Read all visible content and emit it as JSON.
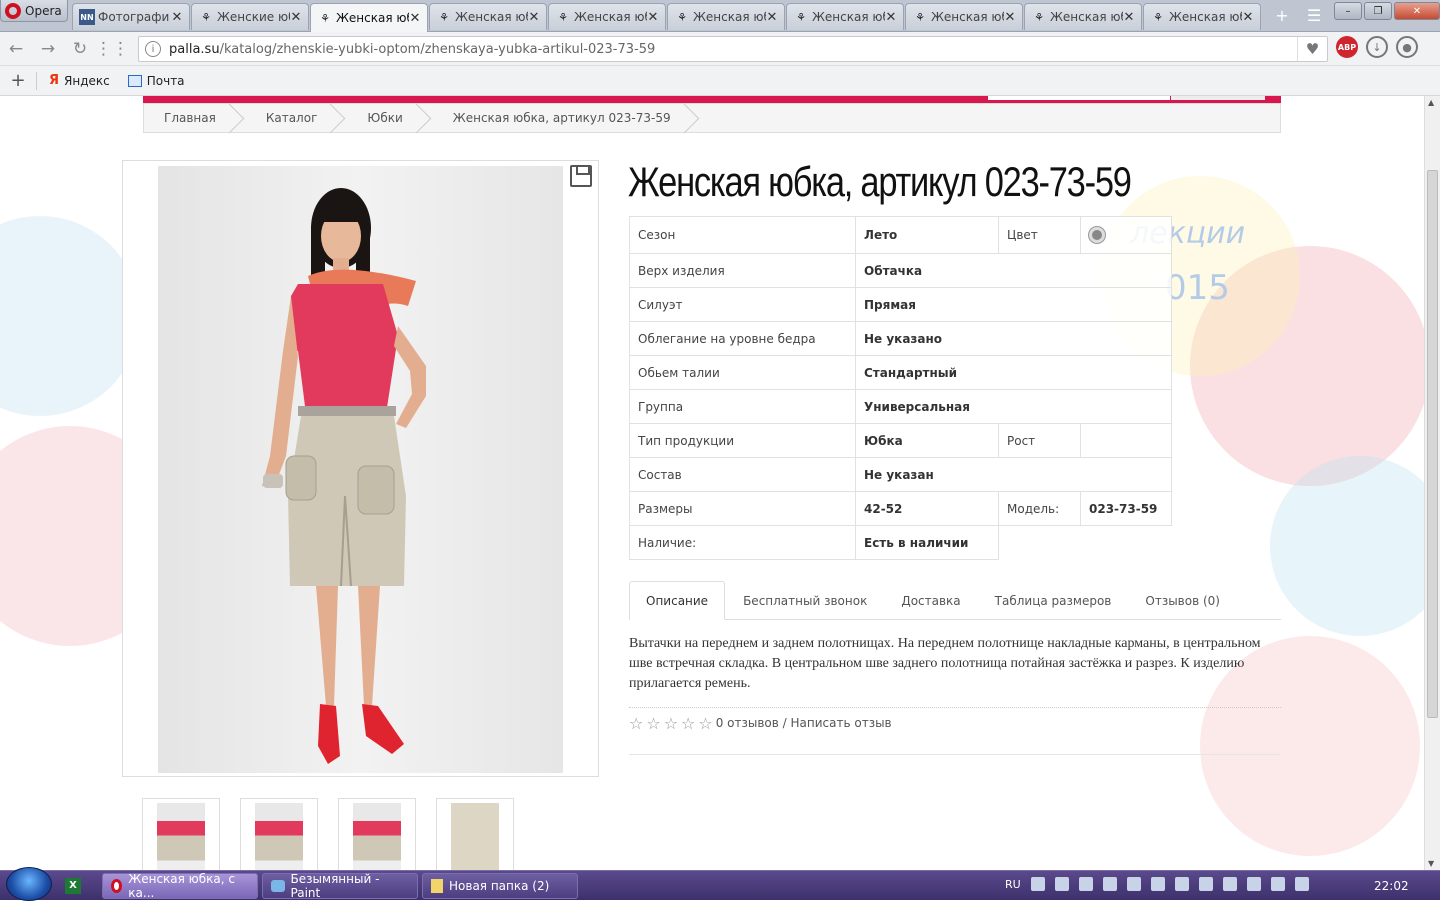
{
  "browser": {
    "app_name": "Opera",
    "tabs": [
      {
        "label": "Фотографи",
        "icon": "nn",
        "active": false
      },
      {
        "label": "Женские юб",
        "icon": "palla",
        "active": false
      },
      {
        "label": "Женская юб",
        "icon": "palla",
        "active": true
      },
      {
        "label": "Женская юб",
        "icon": "palla",
        "active": false
      },
      {
        "label": "Женская юб",
        "icon": "palla",
        "active": false
      },
      {
        "label": "Женская юб",
        "icon": "palla",
        "active": false
      },
      {
        "label": "Женская юб",
        "icon": "palla",
        "active": false
      },
      {
        "label": "Женская юб",
        "icon": "palla",
        "active": false
      },
      {
        "label": "Женская юб",
        "icon": "palla",
        "active": false
      },
      {
        "label": "Женская юб",
        "icon": "palla",
        "active": false
      }
    ],
    "nn_badge": "NN",
    "url_host": "palla.su",
    "url_path": "/katalog/zhenskie-yubki-optom/zhenskaya-yubka-artikul-023-73-59",
    "abp_label": "ABP",
    "bookmarks": [
      {
        "icon": "yandex-icon",
        "label": "Яндекс",
        "glyph": "Я"
      },
      {
        "icon": "mail-icon",
        "label": "Почта"
      }
    ]
  },
  "page": {
    "breadcrumb": [
      "Главная",
      "Каталог",
      "Юбки",
      "Женская юбка, артикул 023-73-59"
    ],
    "title": "Женская юбка, артикул 023-73-59",
    "deco_text_1": "лекции",
    "deco_text_2": "015",
    "properties": {
      "season_label": "Сезон",
      "season_value": "Лето",
      "color_label": "Цвет",
      "upper_label": "Верх изделия",
      "upper_value": "Обтачка",
      "silhouette_label": "Силуэт",
      "silhouette_value": "Прямая",
      "fit_label": "Облегание на уровне бедра",
      "fit_value": "Не указано",
      "waist_label": "Обьем талии",
      "waist_value": "Стандартный",
      "group_label": "Группа",
      "group_value": "Универсальная",
      "type_label": "Тип продукции",
      "type_value": "Юбка",
      "height_label": "Рост",
      "height_value": "",
      "composition_label": "Состав",
      "composition_value": "Не указан",
      "sizes_label": "Размеры",
      "sizes_value": "42-52",
      "model_label": "Модель:",
      "model_value": "023-73-59",
      "availability_label": "Наличие:",
      "availability_value": "Есть в наличии"
    },
    "tabs": [
      "Описание",
      "Бесплатный звонок",
      "Доставка",
      "Таблица размеров",
      "Отзывов (0)"
    ],
    "active_tab": 0,
    "description": "Вытачки на переднем и заднем полотнищах. На переднем полотнище накладные карманы, в центральном шве встречная складка. В центральном шве заднего полотнища потайная застёжка и разрез. К изделию прилагается ремень.",
    "rating": 0,
    "reviews_text": "0 отзывов / Написать отзыв",
    "thumbnail_count": 4
  },
  "taskbar": {
    "apps": [
      {
        "label": "Женская юбка, с ка...",
        "active": true
      },
      {
        "label": "Безымянный - Paint",
        "active": false
      },
      {
        "label": "Новая папка (2)",
        "active": false
      }
    ],
    "excel_glyph": "X",
    "lang": "RU",
    "time": "22:02"
  },
  "colors": {
    "brand": "#d8174f",
    "taskbar": "#4a3b7c"
  }
}
